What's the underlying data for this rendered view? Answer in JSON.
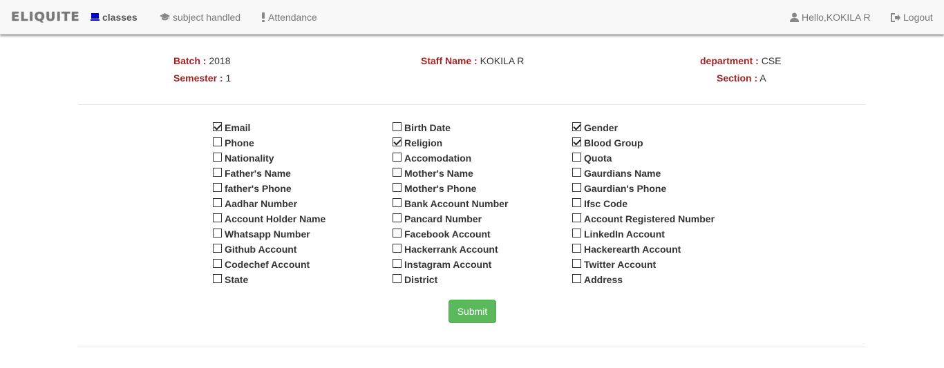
{
  "navbar": {
    "brand": "ELIQUITE",
    "items": [
      {
        "label": "classes",
        "icon": "monitor-icon"
      },
      {
        "label": "subject handled",
        "icon": "graduation-cap-icon"
      },
      {
        "label": "Attendance",
        "icon": "exclamation-icon"
      }
    ],
    "user_greeting": "Hello,KOKILA R",
    "logout_label": "Logout",
    "colors": {
      "active_icon": "#0000cc",
      "text": "#777777"
    }
  },
  "info": {
    "batch_label": "Batch :",
    "batch_value": "2018",
    "semester_label": "Semester :",
    "semester_value": "1",
    "staff_label": "Staff Name :",
    "staff_value": "KOKILA R",
    "department_label": "department :",
    "department_value": "CSE",
    "section_label": "Section :",
    "section_value": "A",
    "label_color": "#a02424"
  },
  "fields": {
    "col1": [
      {
        "label": "Email",
        "checked": true
      },
      {
        "label": "Phone",
        "checked": false
      },
      {
        "label": "Nationality",
        "checked": false
      },
      {
        "label": "Father's Name",
        "checked": false
      },
      {
        "label": "father's Phone",
        "checked": false
      },
      {
        "label": "Aadhar Number",
        "checked": false
      },
      {
        "label": "Account Holder Name",
        "checked": false
      },
      {
        "label": "Whatsapp Number",
        "checked": false
      },
      {
        "label": "Github Account",
        "checked": false
      },
      {
        "label": "Codechef Account",
        "checked": false
      },
      {
        "label": "State",
        "checked": false
      }
    ],
    "col2": [
      {
        "label": "Birth Date",
        "checked": false
      },
      {
        "label": "Religion",
        "checked": true
      },
      {
        "label": "Accomodation",
        "checked": false
      },
      {
        "label": "Mother's Name",
        "checked": false
      },
      {
        "label": "Mother's Phone",
        "checked": false
      },
      {
        "label": "Bank Account Number",
        "checked": false
      },
      {
        "label": "Pancard Number",
        "checked": false
      },
      {
        "label": "Facebook Account",
        "checked": false
      },
      {
        "label": "Hackerrank Account",
        "checked": false
      },
      {
        "label": "Instagram Account",
        "checked": false
      },
      {
        "label": "District",
        "checked": false
      }
    ],
    "col3": [
      {
        "label": "Gender",
        "checked": true
      },
      {
        "label": "Blood Group",
        "checked": true
      },
      {
        "label": "Quota",
        "checked": false
      },
      {
        "label": "Gaurdians Name",
        "checked": false
      },
      {
        "label": "Gaurdian's Phone",
        "checked": false
      },
      {
        "label": "Ifsc Code",
        "checked": false
      },
      {
        "label": "Account Registered Number",
        "checked": false
      },
      {
        "label": "LinkedIn Account",
        "checked": false
      },
      {
        "label": "Hackerearth Account",
        "checked": false
      },
      {
        "label": "Twitter Account",
        "checked": false
      },
      {
        "label": "Address",
        "checked": false
      }
    ]
  },
  "submit_label": "Submit",
  "submit_color": "#5cb85c"
}
